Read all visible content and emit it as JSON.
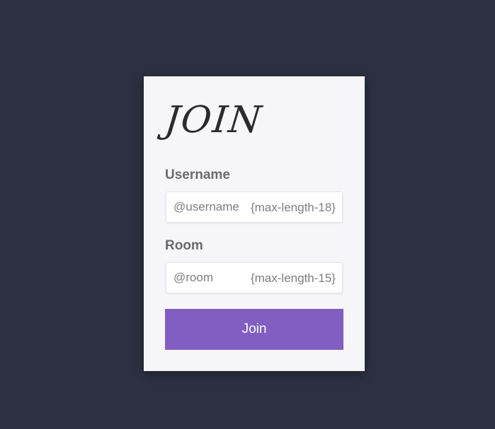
{
  "form": {
    "title": "JOIN",
    "username": {
      "label": "Username",
      "placeholder": "@username",
      "hint": "{max-length-18}",
      "value": ""
    },
    "room": {
      "label": "Room",
      "placeholder": "@room",
      "hint": "{max-length-15}",
      "value": ""
    },
    "submit_label": "Join"
  },
  "colors": {
    "background": "#2c3040",
    "card": "#f6f6f8",
    "accent": "#825ec2"
  }
}
